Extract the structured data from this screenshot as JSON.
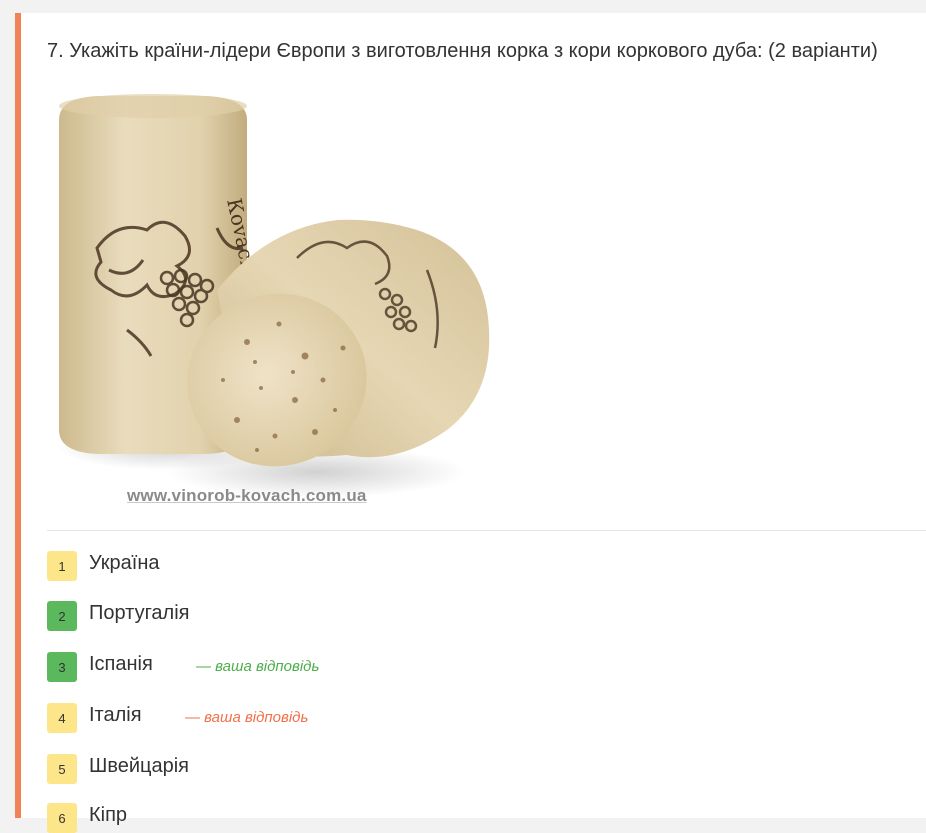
{
  "question": {
    "text": "7. Укажіть країни-лідери Європи з виготовлення корка з кори коркового дуба: (2 варіанти)"
  },
  "image": {
    "watermark": "www.vinorob-kovach.com.ua",
    "cork_text": "Кovach"
  },
  "colors": {
    "accent": "#f0825a",
    "badge_neutral": "#fde58a",
    "badge_correct": "#5cb85c",
    "note_correct": "#4cae4c",
    "note_wrong": "#f0704a"
  },
  "options": [
    {
      "number": "1",
      "label": "Україна",
      "status": "neutral",
      "note": ""
    },
    {
      "number": "2",
      "label": "Португалія",
      "status": "correct",
      "note": ""
    },
    {
      "number": "3",
      "label": "Іспанія",
      "status": "correct",
      "note": "— ваша відповідь",
      "note_status": "correct"
    },
    {
      "number": "4",
      "label": "Італія",
      "status": "neutral",
      "note": "— ваша відповідь",
      "note_status": "wrong"
    },
    {
      "number": "5",
      "label": "Швейцарія",
      "status": "neutral",
      "note": ""
    },
    {
      "number": "6",
      "label": "Кіпр",
      "status": "neutral",
      "note": ""
    }
  ]
}
